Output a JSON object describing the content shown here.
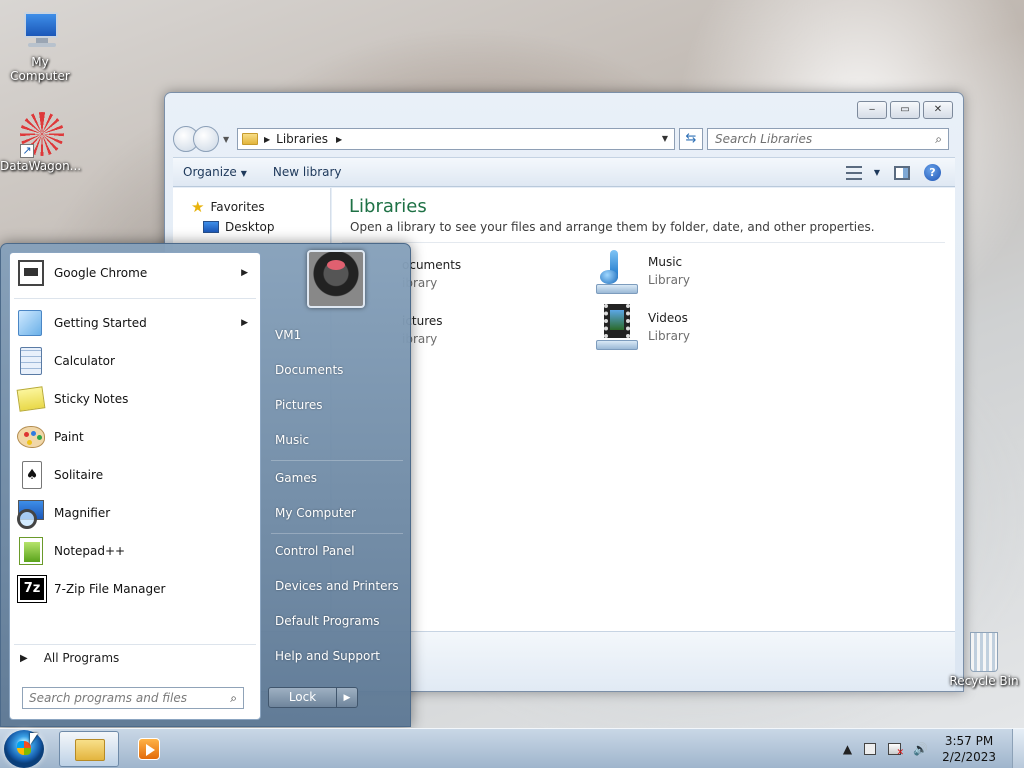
{
  "desktop": {
    "icons": [
      {
        "label": "My Computer",
        "icon": "computer-icon"
      },
      {
        "label": "DataWagon...",
        "icon": "datawagon-icon"
      }
    ],
    "recycle_bin": {
      "label": "Recycle Bin",
      "icon": "recycle-bin-icon"
    }
  },
  "explorer": {
    "address": {
      "crumb": "Libraries"
    },
    "search_placeholder": "Search Libraries",
    "toolbar": {
      "organize": "Organize",
      "new_library": "New library"
    },
    "navpane": {
      "favorites": "Favorites",
      "desktop": "Desktop"
    },
    "content": {
      "title": "Libraries",
      "subtitle": "Open a library to see your files and arrange them by folder, date, and other properties.",
      "libraries": [
        {
          "name": "ocuments",
          "type": "ibrary"
        },
        {
          "name": "Music",
          "type": "Library"
        },
        {
          "name": "ictures",
          "type": "ibrary"
        },
        {
          "name": "Videos",
          "type": "Library"
        }
      ]
    }
  },
  "start_menu": {
    "programs": [
      {
        "label": "Google Chrome",
        "icon": "chrome-icon",
        "submenu": true
      },
      {
        "label": "Getting Started",
        "icon": "getting-started-icon",
        "submenu": true
      },
      {
        "label": "Calculator",
        "icon": "calculator-icon",
        "submenu": false
      },
      {
        "label": "Sticky Notes",
        "icon": "sticky-notes-icon",
        "submenu": false
      },
      {
        "label": "Paint",
        "icon": "paint-icon",
        "submenu": false
      },
      {
        "label": "Solitaire",
        "icon": "solitaire-icon",
        "submenu": false
      },
      {
        "label": "Magnifier",
        "icon": "magnifier-icon",
        "submenu": false
      },
      {
        "label": "Notepad++",
        "icon": "notepadpp-icon",
        "submenu": false
      },
      {
        "label": "7-Zip File Manager",
        "icon": "7zip-icon",
        "submenu": false
      }
    ],
    "all_programs": "All Programs",
    "search_placeholder": "Search programs and files",
    "right_items": [
      "VM1",
      "Documents",
      "Pictures",
      "Music",
      "Games",
      "My Computer",
      "Control Panel",
      "Devices and Printers",
      "Default Programs",
      "Help and Support"
    ],
    "lock_label": "Lock",
    "seven_z_glyph": "7z"
  },
  "taskbar": {
    "clock": {
      "time": "3:57 PM",
      "date": "2/2/2023"
    }
  }
}
